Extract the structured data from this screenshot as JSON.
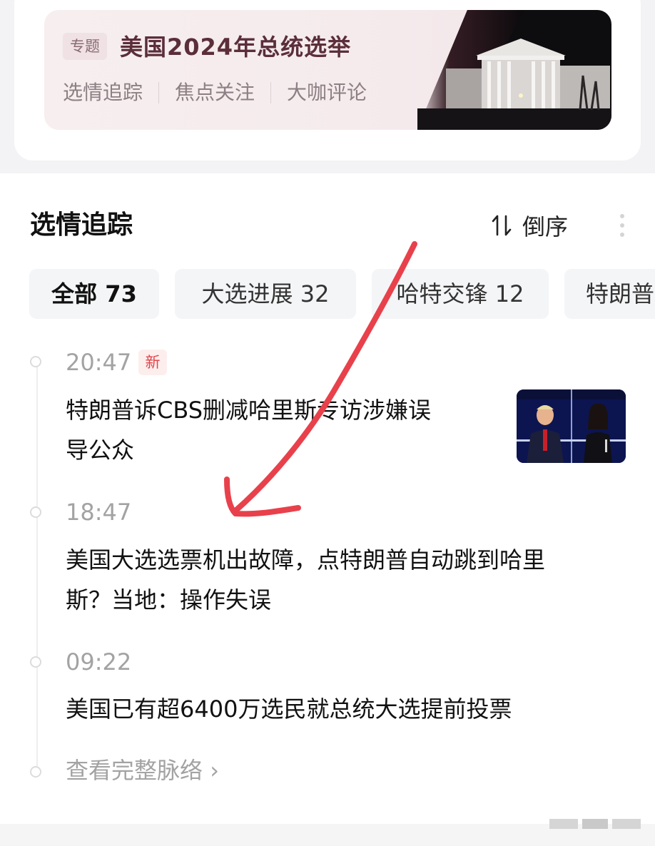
{
  "topic": {
    "tag": "专题",
    "title": "美国2024年总统选举",
    "links": [
      "选情追踪",
      "焦点关注",
      "大咖评论"
    ]
  },
  "section": {
    "title": "选情追踪",
    "sort_label": "倒序"
  },
  "filters": [
    {
      "label": "全部 73",
      "active": true
    },
    {
      "label": "大选进展 32",
      "active": false
    },
    {
      "label": "哈特交锋 12",
      "active": false
    },
    {
      "label": "特朗普",
      "active": false
    }
  ],
  "timeline": [
    {
      "time": "20:47",
      "badge": "新",
      "line1": "特朗普诉CBS删减哈里斯专访涉嫌误",
      "line2": "导公众"
    },
    {
      "time": "18:47",
      "line1": "美国大选选票机出故障，点特朗普自动跳到哈里",
      "line2": "斯？当地：操作失误"
    },
    {
      "time": "09:22",
      "line1": "美国已有超6400万选民就总统大选提前投票"
    }
  ],
  "more_link": "查看完整脉络",
  "colors": {
    "topic_title": "#5b2e3a",
    "badge_text": "#e0454a",
    "annotation_arrow": "#e8414b"
  }
}
